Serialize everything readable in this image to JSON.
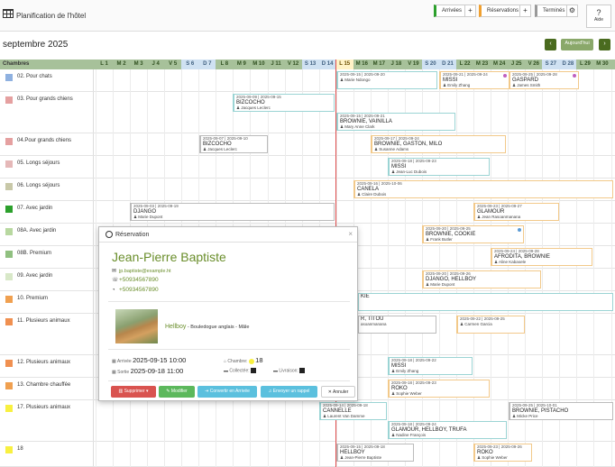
{
  "app": {
    "title": "Planification de l'hôtel"
  },
  "toolbar": {
    "arrivees": "Arrivées",
    "reservations": "Réservations",
    "termines": "Terminés",
    "plus": "+",
    "settings": "⚙",
    "aide": "Aide",
    "help_icon": "?"
  },
  "calendar": {
    "month": "septembre 2025",
    "prev": "‹",
    "today": "Aujourd'hui",
    "next": "›",
    "rooms_header": "Chambres",
    "days": [
      "L 1",
      "M 2",
      "M 3",
      "J 4",
      "V 5",
      "S 6",
      "D 7",
      "L 8",
      "M 9",
      "M 10",
      "J 11",
      "V 12",
      "S 13",
      "D 14",
      "L 15",
      "M 16",
      "M 17",
      "J 18",
      "V 19",
      "S 20",
      "D 21",
      "L 22",
      "M 23",
      "M 24",
      "J 25",
      "V 26",
      "S 27",
      "D 28",
      "L 29",
      "M 30"
    ]
  },
  "rooms": [
    {
      "name": "02. Pour chats",
      "color": "#8fb1e0"
    },
    {
      "name": "03. Pour grands chiens",
      "color": "#e5a0a0"
    },
    {
      "name": "04.Pour grands chiens",
      "color": "#e5a0a0"
    },
    {
      "name": "05. Longs séjours",
      "color": "#e5b8b8"
    },
    {
      "name": "06. Longs séjours",
      "color": "#c8c8a8"
    },
    {
      "name": "07. Avec jardin",
      "color": "#2ca02c"
    },
    {
      "name": "08A. Avec jardin",
      "color": "#b8d8a0"
    },
    {
      "name": "08B. Premium",
      "color": "#90c080"
    },
    {
      "name": "09. Avec jardin",
      "color": "#d8e8c8"
    },
    {
      "name": "10. Premium",
      "color": "#f0a050"
    },
    {
      "name": "11. Plusieurs animaux",
      "color": "#f09050"
    },
    {
      "name": "12. Plusieurs animaux",
      "color": "#f09050"
    },
    {
      "name": "13. Chambre chauffée",
      "color": "#f0a050"
    },
    {
      "name": "17. Plusieurs animaux",
      "color": "#f8f040"
    },
    {
      "name": "18",
      "color": "#f8f040"
    }
  ],
  "bookings": [
    {
      "dates": "2025-09-15 | 2025-09-20",
      "pet": "",
      "client": "Marie Ndongo"
    },
    {
      "dates": "2025-09-21 | 2025-09-24",
      "pet": "MISSI",
      "client": "Emily Zhang"
    },
    {
      "dates": "2025-09-25 | 2025-09-28",
      "pet": "GASPARD",
      "client": "James Smith"
    },
    {
      "dates": "2025-09-09 | 2025-09-15",
      "pet": "BIZCOCHO",
      "client": "Jacques Leclerc"
    },
    {
      "dates": "2025-09-15 | 2025-09-21",
      "pet": "BROWNIE, VAINILLA",
      "client": "Mary Anne Clark"
    },
    {
      "dates": "2025-09-07 | 2025-09-10",
      "pet": "BIZCOCHO",
      "client": "Jacques Leclerc"
    },
    {
      "dates": "2025-09-17 | 2025-09-24",
      "pet": "BROWNIE, GASTON, MILO",
      "client": "Susanne Adams"
    },
    {
      "dates": "2025-09-18 | 2025-09-23",
      "pet": "MISSI",
      "client": "Jean-Luc Dubois"
    },
    {
      "dates": "2025-09-16 | 2025-10-06",
      "pet": "CANELA",
      "client": "Claire Dubois"
    },
    {
      "dates": "2025-09-03 | 2025-09-19",
      "pet": "DJANGO",
      "client": "Marie Dupont"
    },
    {
      "dates": "2025-09-23 | 2025-09-27",
      "pet": "GLAMOUR",
      "client": "Jean Rasoanmanana"
    },
    {
      "dates": "2025-09-20 | 2025-09-25",
      "pet": "BROWNIE, COOKIE",
      "client": "Frank Butler"
    },
    {
      "dates": "2025-09-24 | 2025-09-28",
      "pet": "AFRODITA, BROWNIE",
      "client": "Aline Kabasele"
    },
    {
      "dates": "2025-09-20 | 2025-09-26",
      "pet": "DJANGO, HELLBOY",
      "client": "Marie Dupont"
    },
    {
      "dates": "",
      "pet": "KIE",
      "client": ""
    },
    {
      "dates": "2025-09-22 | 2025-09-25",
      "pet": "",
      "client": "Carmen Garcia"
    },
    {
      "dates": "",
      "pet": "R, TITOU",
      "client": "asoanmanana"
    },
    {
      "dates": "2025-09-18 | 2025-09-22",
      "pet": "MISSI",
      "client": "Emily Zhang"
    },
    {
      "dates": "2025-09-18 | 2025-09-23",
      "pet": "ROKO",
      "client": "Sophie Weber"
    },
    {
      "dates": "2025-09-14 | 2025-09-18",
      "pet": "CANNELLE",
      "client": "Laurent Van Damme"
    },
    {
      "dates": "2025-09-18 | 2025-09-24",
      "pet": "GLAMOUR, HELLBOY, TRUFA",
      "client": "Nadine François"
    },
    {
      "dates": "2025-09-25 | 2025-10-01",
      "pet": "BROWNIE, PISTACHO",
      "client": "Micke Price"
    },
    {
      "dates": "2025-09-15 | 2025-09-18",
      "pet": "HELLBOY",
      "client": "Jean-Pierre Baptiste"
    },
    {
      "dates": "2025-09-23 | 2025-09-26",
      "pet": "ROKO",
      "client": "Sophie Weber"
    }
  ],
  "popup": {
    "title": "Réservation",
    "close": "×",
    "name": "Jean-Pierre Baptiste",
    "email": "jp.baptiste@example.ht",
    "phone": "+50934567890",
    "whatsapp": "+50934567890",
    "pet_name": "Hellboy",
    "pet_desc": " - Bouledogue anglais - Mâle",
    "arrival_label": "Arrivée",
    "arrival": "2025-09-15  10:00",
    "exit_label": "Sortie",
    "exit": "2025-09-18  11:00",
    "room_label": "Chambre:",
    "room": "18",
    "collect_label": "Collectée:",
    "delivery_label": "Livraison:",
    "btn_delete": "Supprimer",
    "btn_edit": "Modifier",
    "btn_convert": "Convertir en Arrivée",
    "btn_remind": "Envoyer un rappel",
    "btn_cancel": "Annuler"
  },
  "colors": {
    "green": "#6a8e2b",
    "delete": "#d9534f",
    "edit": "#5cb85c",
    "info": "#5bc0de",
    "nav": "#4a6b1f"
  }
}
